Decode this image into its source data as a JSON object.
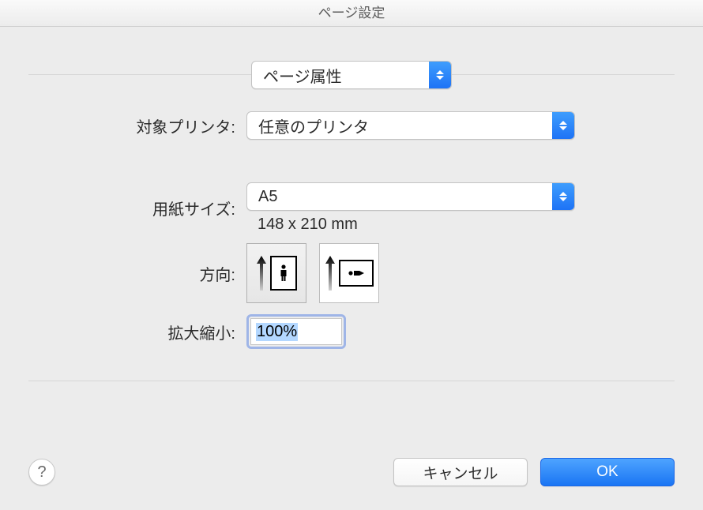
{
  "title": "ページ設定",
  "settings_mode": {
    "label": "ページ属性"
  },
  "printer": {
    "label": "対象プリンタ:",
    "value": "任意のプリンタ"
  },
  "paper": {
    "label": "用紙サイズ:",
    "value": "A5",
    "dimensions": "148 x 210 mm"
  },
  "orientation": {
    "label": "方向:"
  },
  "scale": {
    "label": "拡大縮小:",
    "value": "100%"
  },
  "buttons": {
    "help": "?",
    "cancel": "キャンセル",
    "ok": "OK"
  }
}
